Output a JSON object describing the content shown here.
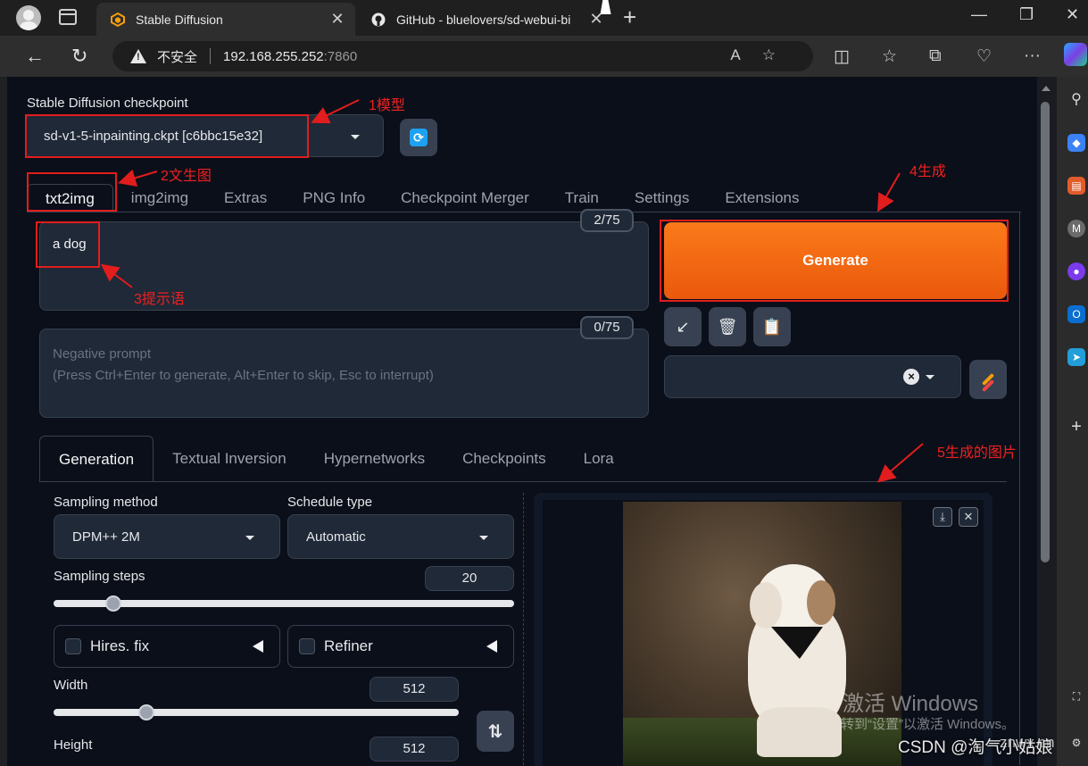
{
  "browser": {
    "tabs": [
      {
        "title": "Stable Diffusion",
        "active": true
      },
      {
        "title": "GitHub - bluelovers/sd-webui-bi",
        "active": false
      }
    ],
    "address": {
      "security_label": "不安全",
      "host": "192.168.255.252",
      "port": ":7860"
    }
  },
  "app": {
    "checkpoint_label": "Stable Diffusion checkpoint",
    "checkpoint_value": "sd-v1-5-inpainting.ckpt [c6bbc15e32]",
    "tabs": [
      "txt2img",
      "img2img",
      "Extras",
      "PNG Info",
      "Checkpoint Merger",
      "Train",
      "Settings",
      "Extensions"
    ],
    "prompt": {
      "text": "a dog",
      "counter": "2/75"
    },
    "negative_prompt": {
      "placeholder_line1": "Negative prompt",
      "placeholder_line2": "(Press Ctrl+Enter to generate, Alt+Enter to skip, Esc to interrupt)",
      "counter": "0/75"
    },
    "generate_label": "Generate",
    "subtabs": [
      "Generation",
      "Textual Inversion",
      "Hypernetworks",
      "Checkpoints",
      "Lora"
    ],
    "sampling_method": {
      "label": "Sampling method",
      "value": "DPM++ 2M"
    },
    "schedule_type": {
      "label": "Schedule type",
      "value": "Automatic"
    },
    "sampling_steps": {
      "label": "Sampling steps",
      "value": "20",
      "fraction": 0.13
    },
    "hires_fix": {
      "label": "Hires. fix"
    },
    "refiner": {
      "label": "Refiner"
    },
    "width": {
      "label": "Width",
      "value": "512",
      "fraction": 0.23
    },
    "height": {
      "label": "Height",
      "value": "512"
    }
  },
  "annotations": {
    "a1": "1模型",
    "a2": "2文生图",
    "a3": "3提示语",
    "a4": "4生成",
    "a5": "5生成的图片"
  },
  "watermark": {
    "line1": "激活 Windows",
    "line2": "转到“设置”以激活 Windows。",
    "site": "znwx.cn",
    "csdn": "CSDN @淘气小姑娘"
  },
  "colors": {
    "generate": "#ea580c",
    "annotation": "#e11d1d",
    "page_bg": "#0b0f19"
  }
}
